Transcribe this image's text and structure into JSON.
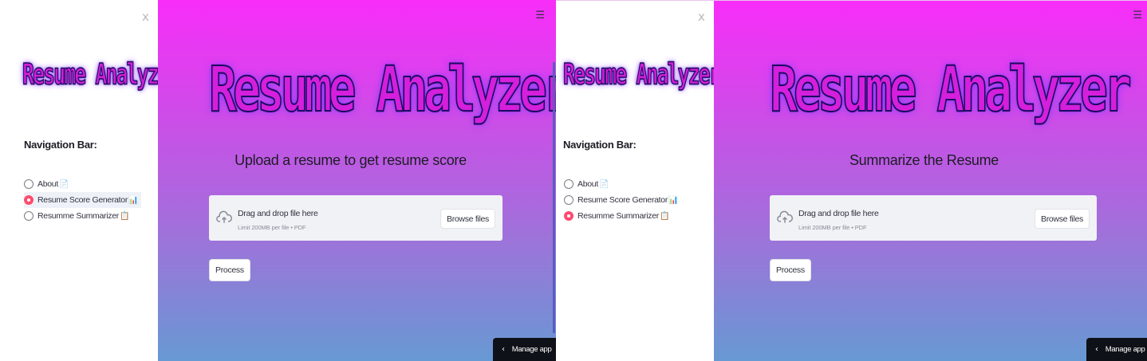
{
  "left": {
    "sidebar": {
      "close": "x",
      "logo_text": "Resume Analyzer",
      "nav_title": "Navigation Bar:",
      "options": [
        {
          "label": "About",
          "emoji": "📄",
          "selected": false
        },
        {
          "label": "Resume Score Generator",
          "emoji": "📊",
          "selected": true
        },
        {
          "label": "Resumme Summarizer",
          "emoji": "📋",
          "selected": false
        }
      ]
    },
    "main": {
      "menu_icon": "☰",
      "logo_text": "Resume Analyzer",
      "subheading": "Upload a resume to get resume score",
      "uploader": {
        "drop_text": "Drag and drop file here",
        "limit_text": "Limit 200MB per file • PDF",
        "browse_label": "Browse files"
      },
      "process_label": "Process",
      "manage_app_label": "Manage app"
    }
  },
  "right": {
    "sidebar": {
      "close": "x",
      "logo_text": "Resume Analyzer",
      "nav_title": "Navigation Bar:",
      "options": [
        {
          "label": "About",
          "emoji": "📄",
          "selected": false
        },
        {
          "label": "Resume Score Generator",
          "emoji": "📊",
          "selected": false
        },
        {
          "label": "Resumme Summarizer",
          "emoji": "📋",
          "selected": true
        }
      ]
    },
    "main": {
      "menu_icon": "☰",
      "logo_text": "Resume Analyzer",
      "subheading": "Summarize the Resume",
      "uploader": {
        "drop_text": "Drag and drop file here",
        "limit_text": "Limit 200MB per file • PDF",
        "browse_label": "Browse files"
      },
      "process_label": "Process",
      "manage_app_label": "Manage app"
    }
  },
  "colors": {
    "accent_radio": "#ff4b6e",
    "gradient_top": "#f82df9",
    "gradient_bottom": "#6799d3",
    "logo_fill": "#d51fdc"
  },
  "icons": {
    "close": "close-icon",
    "menu": "hamburger-menu-icon",
    "upload": "cloud-upload-icon",
    "chevron": "chevron-left-icon"
  }
}
